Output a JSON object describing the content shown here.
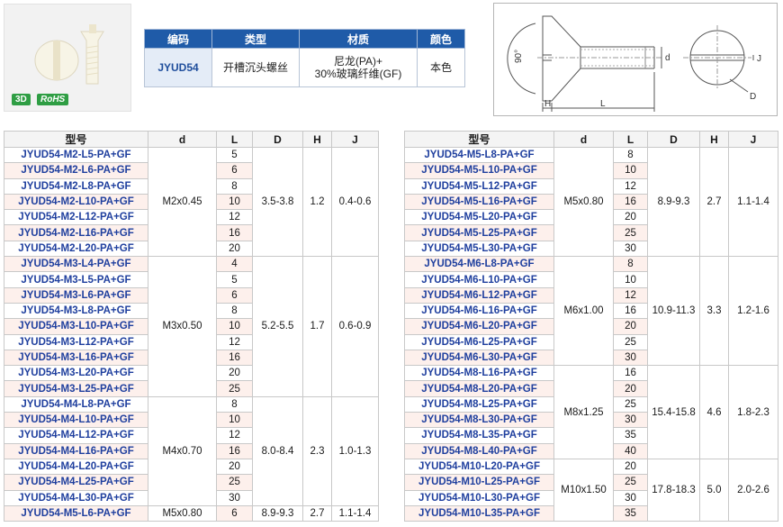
{
  "product": {
    "badge_3d": "3D",
    "badge_rohs": "RoHS",
    "headers": [
      "编码",
      "类型",
      "材质",
      "颜色"
    ],
    "code": "JYUD54",
    "type": "开槽沉头螺丝",
    "material_line1": "尼龙(PA)+",
    "material_line2": "30%玻璃纤维(GF)",
    "color": "本色"
  },
  "diagram": {
    "angle": "90°",
    "label_d": "d",
    "label_h": "H",
    "label_l": "L",
    "label_j": "J",
    "label_D": "D"
  },
  "spec_headers": [
    "型号",
    "d",
    "L",
    "D",
    "H",
    "J"
  ],
  "left_rows": [
    {
      "m": "JYUD54-M2-L5-PA+GF",
      "l": "5"
    },
    {
      "m": "JYUD54-M2-L6-PA+GF",
      "l": "6"
    },
    {
      "m": "JYUD54-M2-L8-PA+GF",
      "l": "8"
    },
    {
      "m": "JYUD54-M2-L10-PA+GF",
      "l": "10"
    },
    {
      "m": "JYUD54-M2-L12-PA+GF",
      "l": "12"
    },
    {
      "m": "JYUD54-M2-L16-PA+GF",
      "l": "16"
    },
    {
      "m": "JYUD54-M2-L20-PA+GF",
      "l": "20"
    },
    {
      "m": "JYUD54-M3-L4-PA+GF",
      "l": "4"
    },
    {
      "m": "JYUD54-M3-L5-PA+GF",
      "l": "5"
    },
    {
      "m": "JYUD54-M3-L6-PA+GF",
      "l": "6"
    },
    {
      "m": "JYUD54-M3-L8-PA+GF",
      "l": "8"
    },
    {
      "m": "JYUD54-M3-L10-PA+GF",
      "l": "10"
    },
    {
      "m": "JYUD54-M3-L12-PA+GF",
      "l": "12"
    },
    {
      "m": "JYUD54-M3-L16-PA+GF",
      "l": "16"
    },
    {
      "m": "JYUD54-M3-L20-PA+GF",
      "l": "20"
    },
    {
      "m": "JYUD54-M3-L25-PA+GF",
      "l": "25"
    },
    {
      "m": "JYUD54-M4-L8-PA+GF",
      "l": "8"
    },
    {
      "m": "JYUD54-M4-L10-PA+GF",
      "l": "10"
    },
    {
      "m": "JYUD54-M4-L12-PA+GF",
      "l": "12"
    },
    {
      "m": "JYUD54-M4-L16-PA+GF",
      "l": "16"
    },
    {
      "m": "JYUD54-M4-L20-PA+GF",
      "l": "20"
    },
    {
      "m": "JYUD54-M4-L25-PA+GF",
      "l": "25"
    },
    {
      "m": "JYUD54-M4-L30-PA+GF",
      "l": "30"
    },
    {
      "m": "JYUD54-M5-L6-PA+GF",
      "l": "6"
    }
  ],
  "left_groups": [
    {
      "start": 0,
      "span": 7,
      "d": "M2x0.45",
      "D": "3.5-3.8",
      "H": "1.2",
      "J": "0.4-0.6"
    },
    {
      "start": 7,
      "span": 9,
      "d": "M3x0.50",
      "D": "5.2-5.5",
      "H": "1.7",
      "J": "0.6-0.9"
    },
    {
      "start": 16,
      "span": 7,
      "d": "M4x0.70",
      "D": "8.0-8.4",
      "H": "2.3",
      "J": "1.0-1.3"
    },
    {
      "start": 23,
      "span": 1,
      "d": "M5x0.80",
      "D": "8.9-9.3",
      "H": "2.7",
      "J": "1.1-1.4"
    }
  ],
  "right_rows": [
    {
      "m": "JYUD54-M5-L8-PA+GF",
      "l": "8"
    },
    {
      "m": "JYUD54-M5-L10-PA+GF",
      "l": "10"
    },
    {
      "m": "JYUD54-M5-L12-PA+GF",
      "l": "12"
    },
    {
      "m": "JYUD54-M5-L16-PA+GF",
      "l": "16"
    },
    {
      "m": "JYUD54-M5-L20-PA+GF",
      "l": "20"
    },
    {
      "m": "JYUD54-M5-L25-PA+GF",
      "l": "25"
    },
    {
      "m": "JYUD54-M5-L30-PA+GF",
      "l": "30"
    },
    {
      "m": "JYUD54-M6-L8-PA+GF",
      "l": "8"
    },
    {
      "m": "JYUD54-M6-L10-PA+GF",
      "l": "10"
    },
    {
      "m": "JYUD54-M6-L12-PA+GF",
      "l": "12"
    },
    {
      "m": "JYUD54-M6-L16-PA+GF",
      "l": "16"
    },
    {
      "m": "JYUD54-M6-L20-PA+GF",
      "l": "20"
    },
    {
      "m": "JYUD54-M6-L25-PA+GF",
      "l": "25"
    },
    {
      "m": "JYUD54-M6-L30-PA+GF",
      "l": "30"
    },
    {
      "m": "JYUD54-M8-L16-PA+GF",
      "l": "16"
    },
    {
      "m": "JYUD54-M8-L20-PA+GF",
      "l": "20"
    },
    {
      "m": "JYUD54-M8-L25-PA+GF",
      "l": "25"
    },
    {
      "m": "JYUD54-M8-L30-PA+GF",
      "l": "30"
    },
    {
      "m": "JYUD54-M8-L35-PA+GF",
      "l": "35"
    },
    {
      "m": "JYUD54-M8-L40-PA+GF",
      "l": "40"
    },
    {
      "m": "JYUD54-M10-L20-PA+GF",
      "l": "20"
    },
    {
      "m": "JYUD54-M10-L25-PA+GF",
      "l": "25"
    },
    {
      "m": "JYUD54-M10-L30-PA+GF",
      "l": "30"
    },
    {
      "m": "JYUD54-M10-L35-PA+GF",
      "l": "35"
    }
  ],
  "right_groups": [
    {
      "start": 0,
      "span": 7,
      "d": "M5x0.80",
      "D": "8.9-9.3",
      "H": "2.7",
      "J": "1.1-1.4"
    },
    {
      "start": 7,
      "span": 7,
      "d": "M6x1.00",
      "D": "10.9-11.3",
      "H": "3.3",
      "J": "1.2-1.6"
    },
    {
      "start": 14,
      "span": 6,
      "d": "M8x1.25",
      "D": "15.4-15.8",
      "H": "4.6",
      "J": "1.8-2.3"
    },
    {
      "start": 20,
      "span": 4,
      "d": "M10x1.50",
      "D": "17.8-18.3",
      "H": "5.0",
      "J": "2.0-2.6"
    }
  ]
}
